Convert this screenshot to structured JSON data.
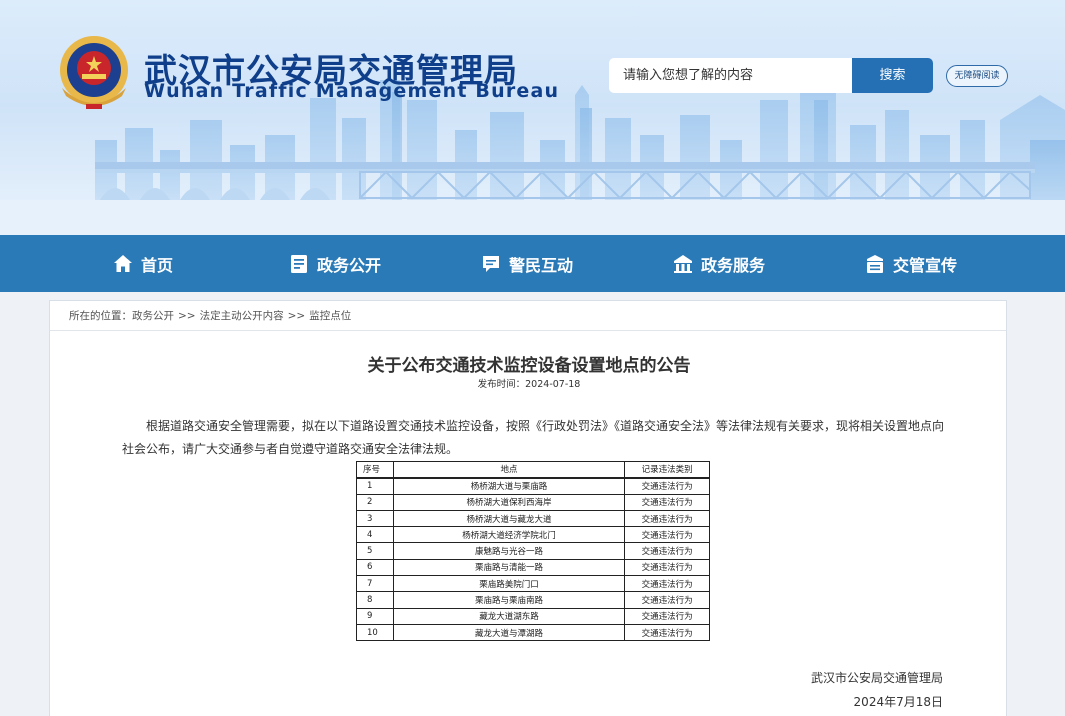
{
  "header": {
    "title_cn": "武汉市公安局交通管理局",
    "title_en": "Wuhan Traffic Management Bureau",
    "logo_icon": "police-emblem-icon",
    "search_placeholder": "请输入您想了解的内容",
    "search_button": "搜索",
    "accessibility_button": "无障碍阅读"
  },
  "nav": {
    "items": [
      {
        "label": "首页",
        "icon": "home-icon"
      },
      {
        "label": "政务公开",
        "icon": "document-icon"
      },
      {
        "label": "警民互动",
        "icon": "chat-icon"
      },
      {
        "label": "政务服务",
        "icon": "service-icon"
      },
      {
        "label": "交管宣传",
        "icon": "publicity-icon"
      }
    ]
  },
  "breadcrumb": {
    "prefix": "所在的位置：",
    "items": [
      "政务公开",
      "法定主动公开内容",
      "监控点位"
    ],
    "separator": ">>"
  },
  "article": {
    "title": "关于公布交通技术监控设备设置地点的公告",
    "publish_date": "发布时间：2024-07-18",
    "paragraph": "根据道路交通安全管理需要，拟在以下道路设置交通技术监控设备，按照《行政处罚法》《道路交通安全法》等法律法规有关要求，现将相关设置地点向社会公布，请广大交通参与者自觉遵守道路交通安全法律法规。",
    "table": {
      "headers": [
        "序号",
        "地点",
        "记录违法类别"
      ],
      "rows": [
        [
          "1",
          "杨桥湖大道与栗庙路",
          "交通违法行为"
        ],
        [
          "2",
          "杨桥湖大道保利西海岸",
          "交通违法行为"
        ],
        [
          "3",
          "杨桥湖大道与藏龙大道",
          "交通违法行为"
        ],
        [
          "4",
          "杨桥湖大道经济学院北门",
          "交通违法行为"
        ],
        [
          "5",
          "康魅路与光谷一路",
          "交通违法行为"
        ],
        [
          "6",
          "栗庙路与清能一路",
          "交通违法行为"
        ],
        [
          "7",
          "栗庙路美院门口",
          "交通违法行为"
        ],
        [
          "8",
          "栗庙路与栗庙南路",
          "交通违法行为"
        ],
        [
          "9",
          "藏龙大道湖东路",
          "交通违法行为"
        ],
        [
          "10",
          "藏龙大道与潭湖路",
          "交通违法行为"
        ]
      ]
    },
    "signature_org": "武汉市公安局交通管理局",
    "signature_date": "2024年7月18日"
  },
  "colors": {
    "nav_background": "#2a7ab8",
    "title_blue": "#0f3f8a",
    "search_button": "#2570b5"
  }
}
